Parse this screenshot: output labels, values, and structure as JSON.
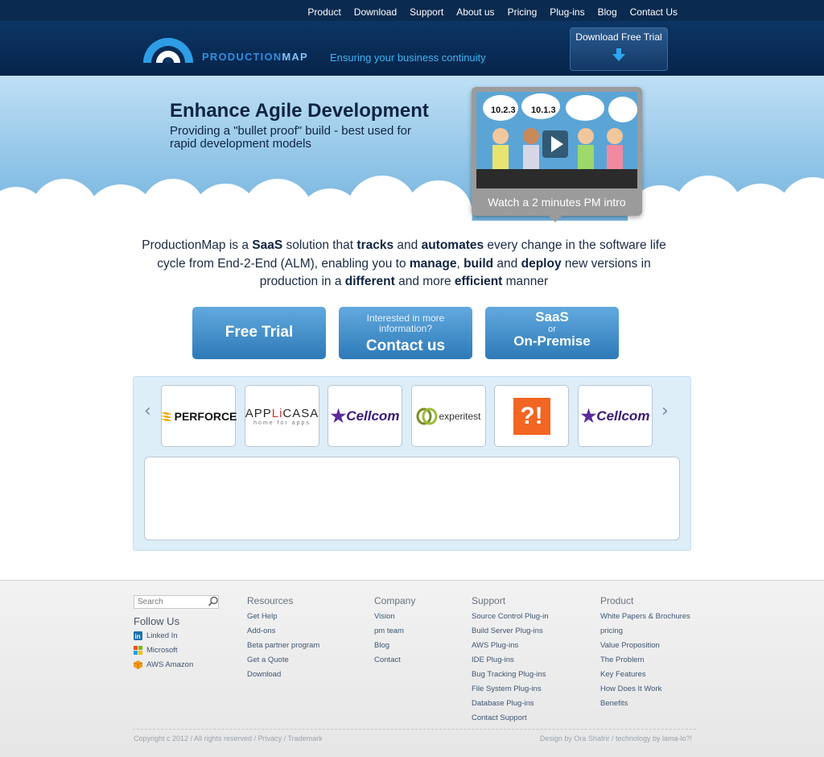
{
  "nav": {
    "items": [
      "Product",
      "Download",
      "Support",
      "About us",
      "Pricing",
      "Plug-ins",
      "Blog",
      "Contact Us"
    ]
  },
  "header": {
    "brand_part1": "PRODUCTION",
    "brand_part2": "MAP",
    "tagline": "Ensuring your business continuity",
    "download_label": "Download Free Trial"
  },
  "hero": {
    "title": "Enhance Agile Development",
    "subtitle": "Providing a \"bullet proof\" build - best used for rapid development models",
    "video_caption": "Watch a 2 minutes PM intro",
    "video_bubbles": [
      "10.2.3",
      "10.1.3"
    ]
  },
  "intro": {
    "parts": [
      {
        "t": "ProductionMap is a ",
        "b": false
      },
      {
        "t": "SaaS",
        "b": true
      },
      {
        "t": " solution that ",
        "b": false
      },
      {
        "t": "tracks",
        "b": true
      },
      {
        "t": " and ",
        "b": false
      },
      {
        "t": "automates",
        "b": true
      },
      {
        "t": " every change in the software life cycle from End-2-End (ALM), enabling you to ",
        "b": false
      },
      {
        "t": "manage",
        "b": true
      },
      {
        "t": ", ",
        "b": false
      },
      {
        "t": "build",
        "b": true
      },
      {
        "t": " and ",
        "b": false
      },
      {
        "t": "deploy",
        "b": true
      },
      {
        "t": " new versions in production in a ",
        "b": false
      },
      {
        "t": "different",
        "b": true
      },
      {
        "t": " and more ",
        "b": false
      },
      {
        "t": "efficient",
        "b": true
      },
      {
        "t": " manner",
        "b": false
      }
    ]
  },
  "cta": {
    "free_trial": "Free Trial",
    "contact_small": "Interested in more information?",
    "contact_big": "Contact us",
    "saas_1": "SaaS",
    "saas_or": "or",
    "saas_2": "On-Premise"
  },
  "carousel": {
    "prev": "‹",
    "next": "›",
    "clients": {
      "perforce": "PERFORCE",
      "applicasa_a": "APP",
      "applicasa_l": "Li",
      "applicasa_b": "CASA",
      "applicasa_sub": "home for apps",
      "cellcom": "Cellcom",
      "experitest": "experitest",
      "q": "?!"
    }
  },
  "footer": {
    "search_placeholder": "Search",
    "follow_title": "Follow Us",
    "social": [
      "Linked In",
      "Microsoft",
      "AWS Amazon"
    ],
    "columns": [
      {
        "title": "Resources",
        "links": [
          "Get Help",
          "Add-ons",
          "Beta partner program",
          "Get a Quote",
          "Download"
        ]
      },
      {
        "title": "Company",
        "links": [
          "Vision",
          "pm team",
          "Blog",
          "Contact"
        ]
      },
      {
        "title": "Support",
        "links": [
          "Source Control Plug-in",
          "Build Server Plug-ins",
          "AWS Plug-ins",
          "IDE Plug-ins",
          "Bug Tracking Plug-ins",
          "File System Plug-ins",
          "Database Plug-ins",
          "Contact Support"
        ]
      },
      {
        "title": "Product",
        "links": [
          "White Papers & Brochures",
          "pricing",
          "Value Proposition",
          "The Problem",
          "Key Features",
          "How Does It Work",
          "Benefits"
        ]
      }
    ],
    "copyright": "Copyright c 2012 / All rights reserved / Privacy / Trademark",
    "design": "Design by Ora Shafrir / technology by lama-lo?!"
  },
  "colors": {
    "nav_bg": "#0b2a4f",
    "accent": "#2f8fe0",
    "cta": "#3a87c5"
  }
}
